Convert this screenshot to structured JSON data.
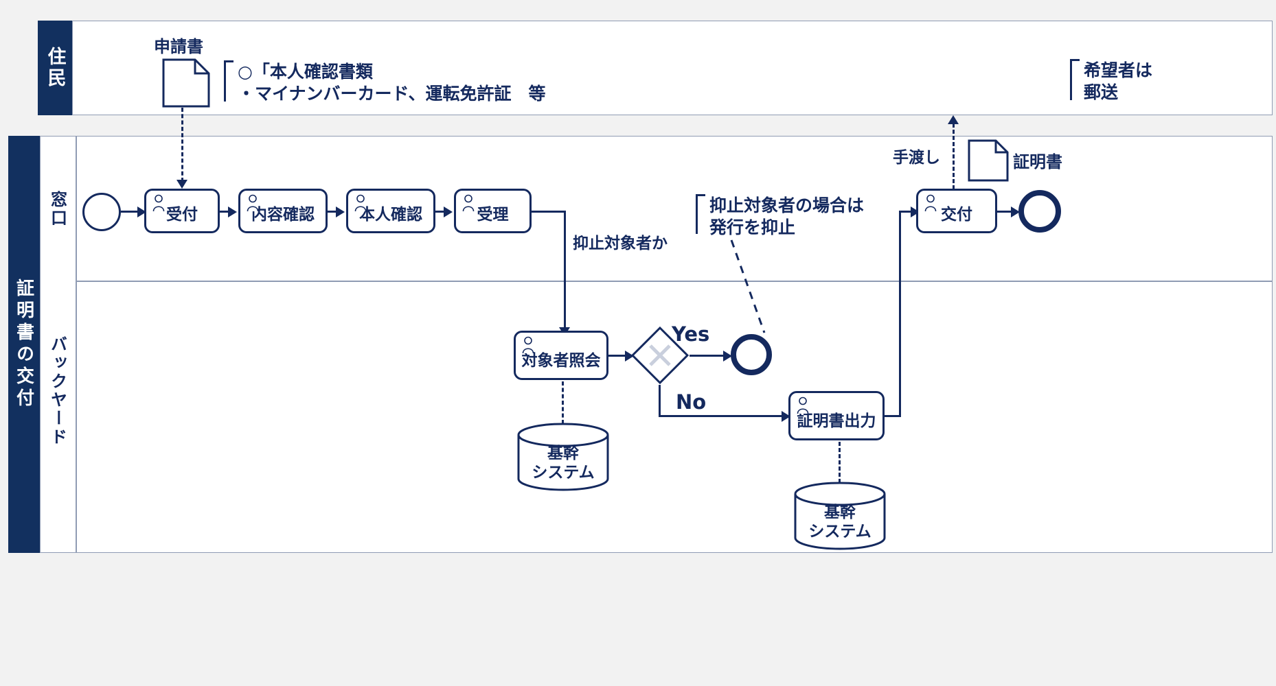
{
  "diagram": {
    "title": "証明書の交付",
    "pools": [
      {
        "id": "resident",
        "label": "住民"
      },
      {
        "id": "certificate-issuance",
        "label": "証明書の交付"
      }
    ],
    "lanes": [
      {
        "id": "madoguchi",
        "label": "窓口"
      },
      {
        "id": "backyard",
        "label": "バックヤード"
      }
    ]
  },
  "tasks": {
    "reception": {
      "label": "受付"
    },
    "content_check": {
      "label": "内容確認"
    },
    "identity_check": {
      "label": "本人確認"
    },
    "acceptance": {
      "label": "受理"
    },
    "target_inquiry": {
      "label": "対象者照会"
    },
    "certificate_out": {
      "label": "証明書出力"
    },
    "delivery": {
      "label": "交付"
    }
  },
  "gateway": {
    "label": "抑止対象者か",
    "yes": "Yes",
    "no": "No"
  },
  "documents": {
    "application": {
      "label": "申請書"
    },
    "certificate": {
      "label": "証明書"
    }
  },
  "databases": {
    "core_system_1": {
      "line1": "基幹",
      "line2": "システム"
    },
    "core_system_2": {
      "line1": "基幹",
      "line2": "システム"
    }
  },
  "annotations": {
    "identity_docs": {
      "line1": "○「本人確認書類",
      "line2": "・マイナンバーカード、運転免許証　等"
    },
    "suppression": {
      "line1": "抑止対象者の場合は",
      "line2": "発行を抑止"
    },
    "mailing": {
      "line1": "希望者は",
      "line2": "郵送"
    },
    "handover": {
      "label": "手渡し"
    }
  },
  "colors": {
    "navy": "#14295e",
    "lane_header_bg": "#12305f",
    "lane_border": "#8f9bb3",
    "page_bg": "#f2f2f2"
  }
}
